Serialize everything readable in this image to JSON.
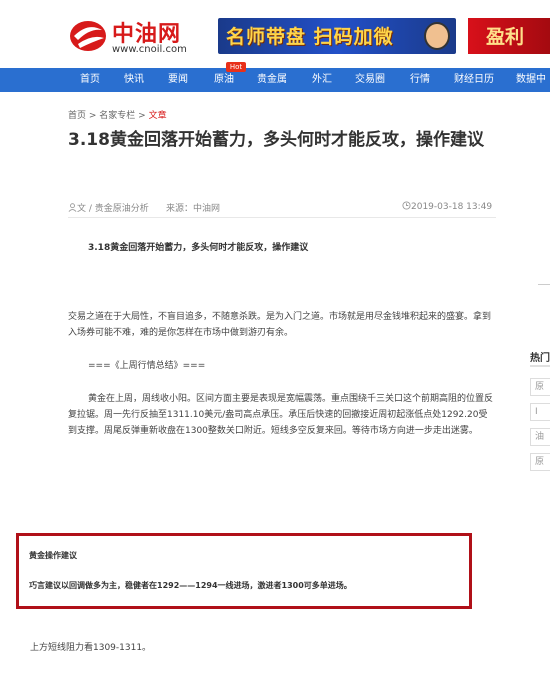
{
  "header": {
    "logo_cn": "中油网",
    "logo_url": "www.cnoil.com",
    "banner_1": "名师带盘 扫码加微",
    "banner_2": "盈利",
    "hot_badge": "Hot"
  },
  "nav": {
    "items": [
      "首页",
      "快讯",
      "要闻",
      "原油",
      "贵金属",
      "外汇",
      "交易圈",
      "行情",
      "财经日历",
      "数据中"
    ]
  },
  "breadcrumb": {
    "home": "首页",
    "sep": " > ",
    "column": "名家专栏",
    "current": "文章"
  },
  "article": {
    "title": "3.18黄金回落开始蓄力，多头何时才能反攻，操作建议",
    "author": "文 / 贵金原油分析",
    "source": "来源：中油网",
    "date": "2019-03-18 13:49",
    "lead": "3.18黄金回落开始蓄力，多头何时才能反攻，操作建议",
    "para1": "交易之道在于大局性，不盲目追多，不随意杀跌。是为入门之道。市场就是用尽金钱堆积起来的盛宴。拿到入场券可能不难，难的是你怎样在市场中做到游刃有余。",
    "section": "===《上周行情总结》===",
    "para2": "黄金在上周，周线收小阳。区间方面主要是表现是宽幅震荡。重点围绕千三关口这个前期高阻的位置反复拉锯。周一先行反抽至1311.10美元/盎司高点承压。承压后快速的回撤接近周初起涨低点处1292.20受到支撑。周尾反弹重新收盘在1300整数关口附近。短线多空反复来回。等待市场方向进一步走出迷雾。",
    "box_title": "黄金操作建议",
    "box_text": "巧言建议以回调做多为主，稳健者在1292——1294一线进场，激进者1300可多单进场。",
    "resistance": "上方短线阻力看1309-1311。"
  },
  "sidebar": {
    "hot_label": "热门",
    "items": [
      "原",
      "I",
      "油",
      "原"
    ]
  }
}
